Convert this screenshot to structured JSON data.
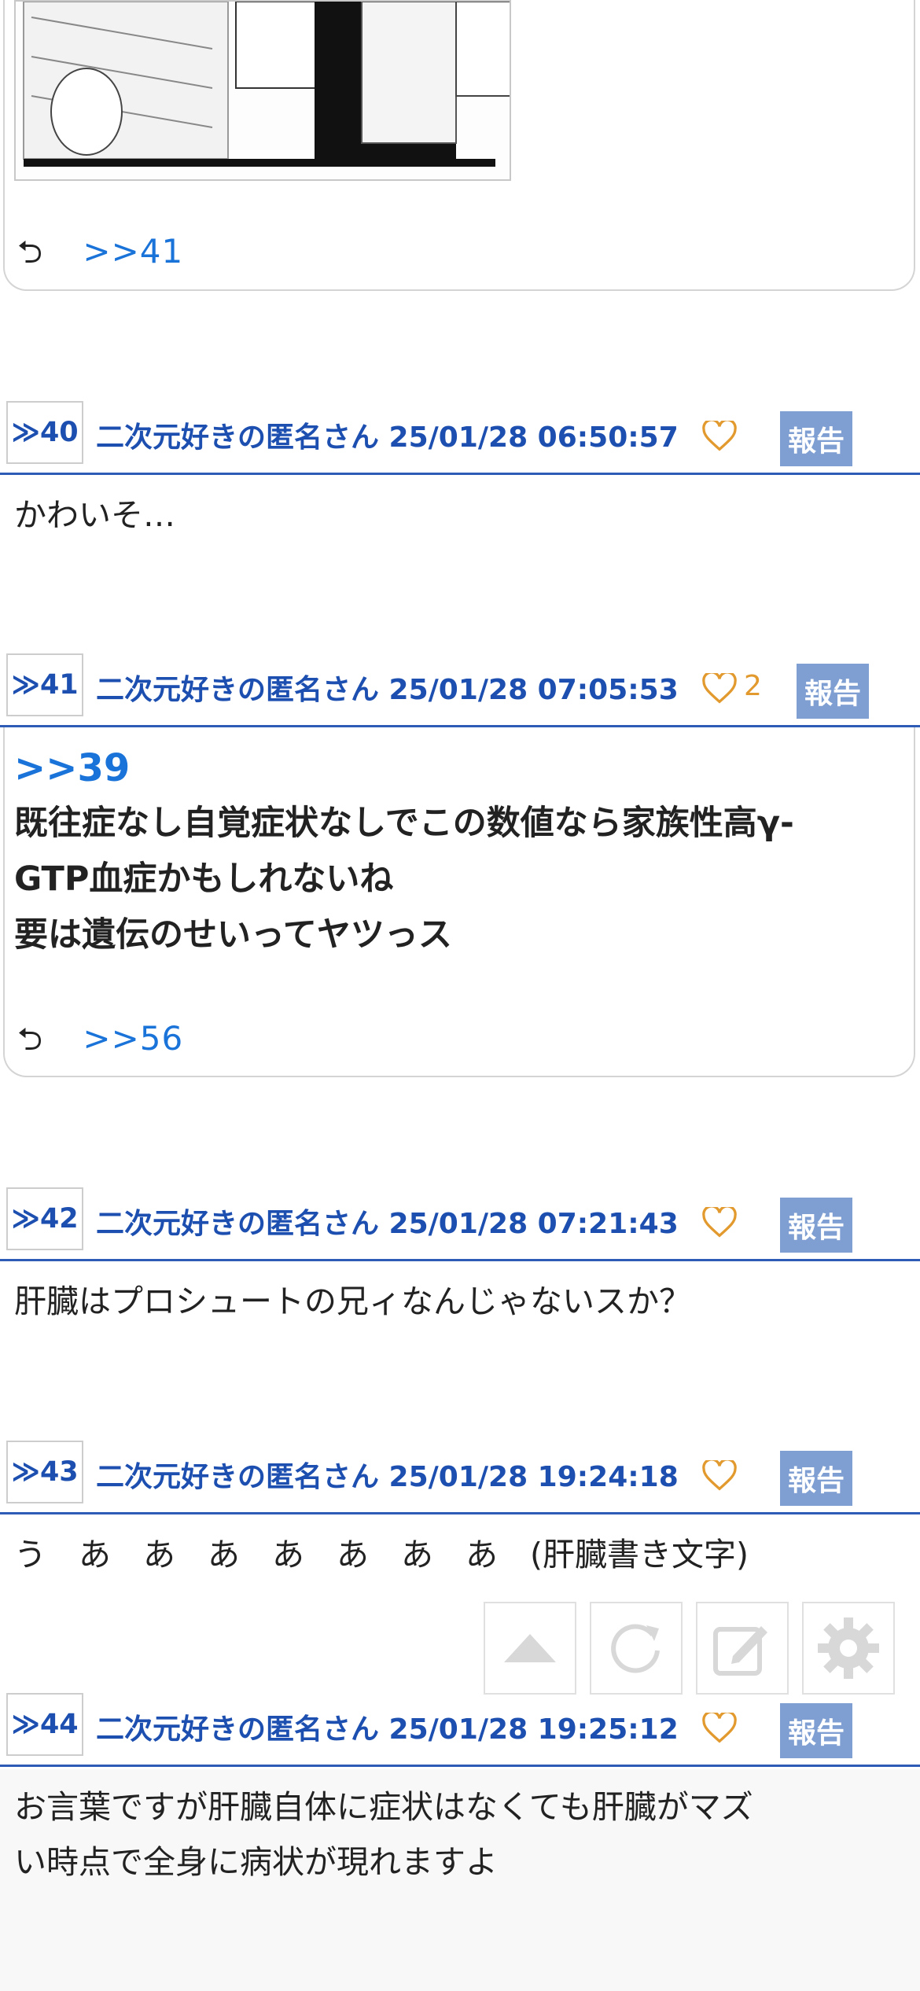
{
  "prev_post": {
    "reply_ref": ">>41"
  },
  "posts": [
    {
      "num": "≫40",
      "author_time": "二次元好きの匿名さん 25/01/28 06:50:57",
      "likes": "",
      "report": "報告",
      "text": "かわいそ…"
    },
    {
      "num": "≫41",
      "author_time": "二次元好きの匿名さん 25/01/28 07:05:53",
      "likes": "2",
      "report": "報告",
      "anchor": ">>39",
      "lines": [
        "既往症なし自覚症状なしでこの数値なら家族性高γ-",
        "GTP血症かもしれないね",
        "要は遺伝のせいってヤツっス"
      ],
      "reply_ref": ">>56"
    },
    {
      "num": "≫42",
      "author_time": "二次元好きの匿名さん 25/01/28 07:21:43",
      "likes": "",
      "report": "報告",
      "text": "肝臓はプロシュートの兄ィなんじゃないスか？"
    },
    {
      "num": "≫43",
      "author_time": "二次元好きの匿名さん 25/01/28 19:24:18",
      "likes": "",
      "report": "報告",
      "text": "う　あ　あ　あ　あ　あ　あ　あ　(肝臓書き文字)"
    },
    {
      "num": "≫44",
      "author_time": "二次元好きの匿名さん 25/01/28 19:25:12",
      "likes": "",
      "report": "報告",
      "lines": [
        "お言葉ですが肝臓自体に症状はなくても肝臓がマズ",
        "い時点で全身に病状が現れますよ"
      ]
    }
  ],
  "toolbar": {
    "items": [
      "scroll-top-icon",
      "refresh-icon",
      "compose-icon",
      "settings-icon"
    ]
  },
  "colors": {
    "accent": "#1c4fb0",
    "link": "#1a73d9",
    "report_bg": "#7f9fd3",
    "heart": "#e29a2e"
  }
}
